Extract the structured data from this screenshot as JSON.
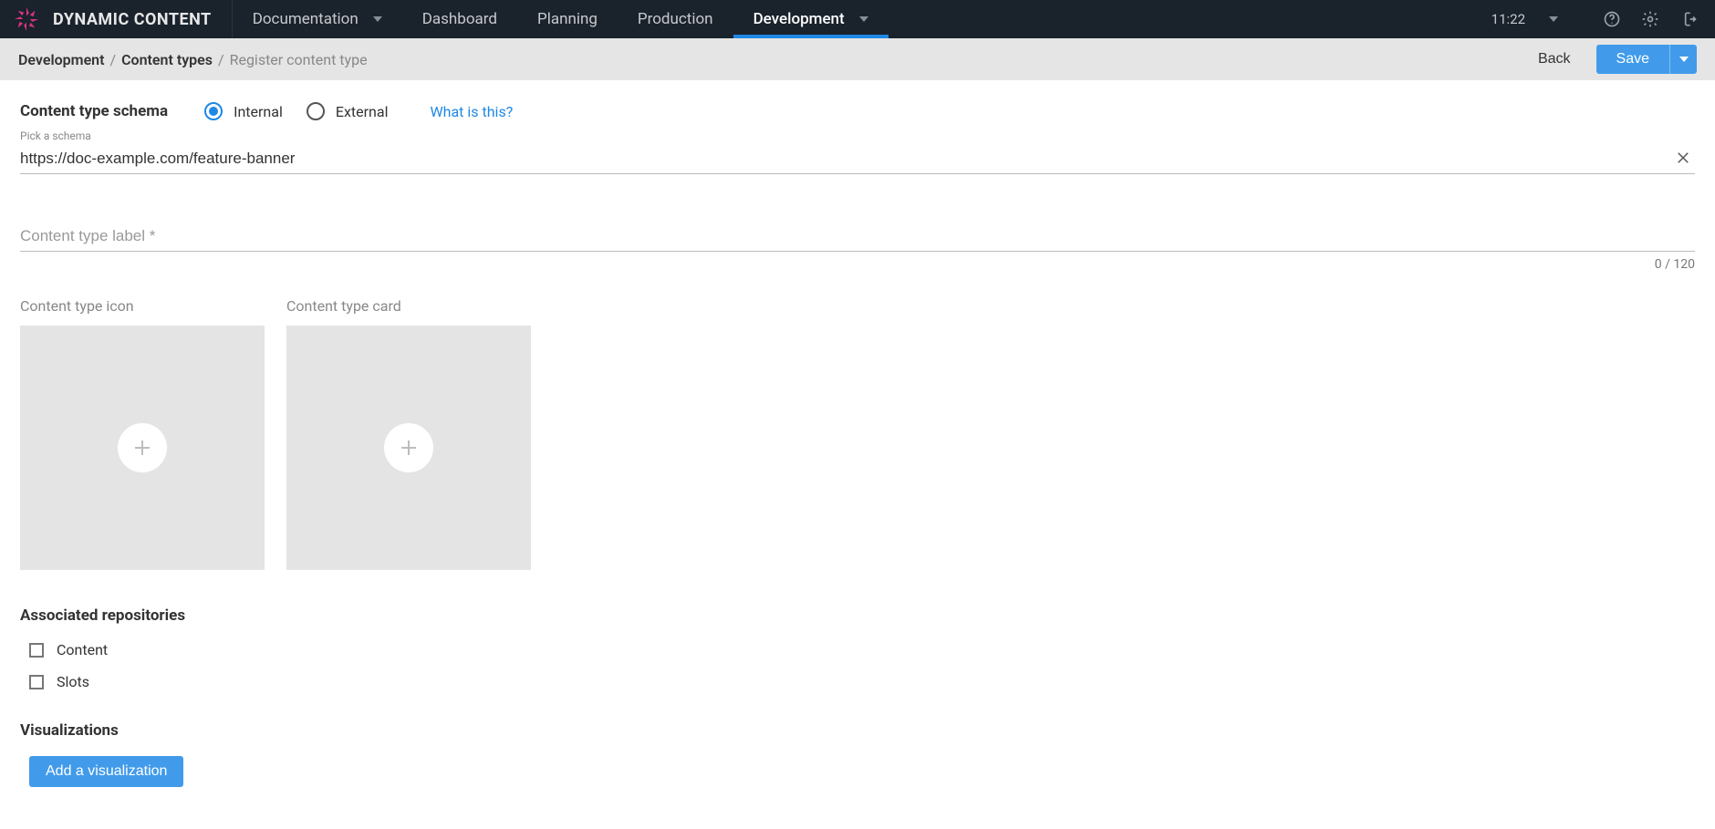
{
  "brand": {
    "name": "DYNAMIC CONTENT"
  },
  "nav": {
    "items": [
      {
        "label": "Documentation",
        "caret": true,
        "active": false
      },
      {
        "label": "Dashboard",
        "caret": false,
        "active": false
      },
      {
        "label": "Planning",
        "caret": false,
        "active": false
      },
      {
        "label": "Production",
        "caret": false,
        "active": false
      },
      {
        "label": "Development",
        "caret": true,
        "active": true
      }
    ],
    "time": "11:22"
  },
  "head": {
    "crumbs": [
      "Development",
      "Content types",
      "Register content type"
    ],
    "back": "Back",
    "save": "Save"
  },
  "schema": {
    "title": "Content type schema",
    "option_internal": "Internal",
    "option_external": "External",
    "selected": "internal",
    "help": "What is this?",
    "hint": "Pick a schema",
    "value": "https://doc-example.com/feature-banner"
  },
  "label_field": {
    "placeholder": "Content type label *",
    "value": "",
    "counter": "0 / 120"
  },
  "uploads": {
    "icon_label": "Content type icon",
    "card_label": "Content type card"
  },
  "repos": {
    "title": "Associated repositories",
    "items": [
      {
        "label": "Content",
        "checked": false
      },
      {
        "label": "Slots",
        "checked": false
      }
    ]
  },
  "viz": {
    "title": "Visualizations",
    "button": "Add a visualization"
  }
}
